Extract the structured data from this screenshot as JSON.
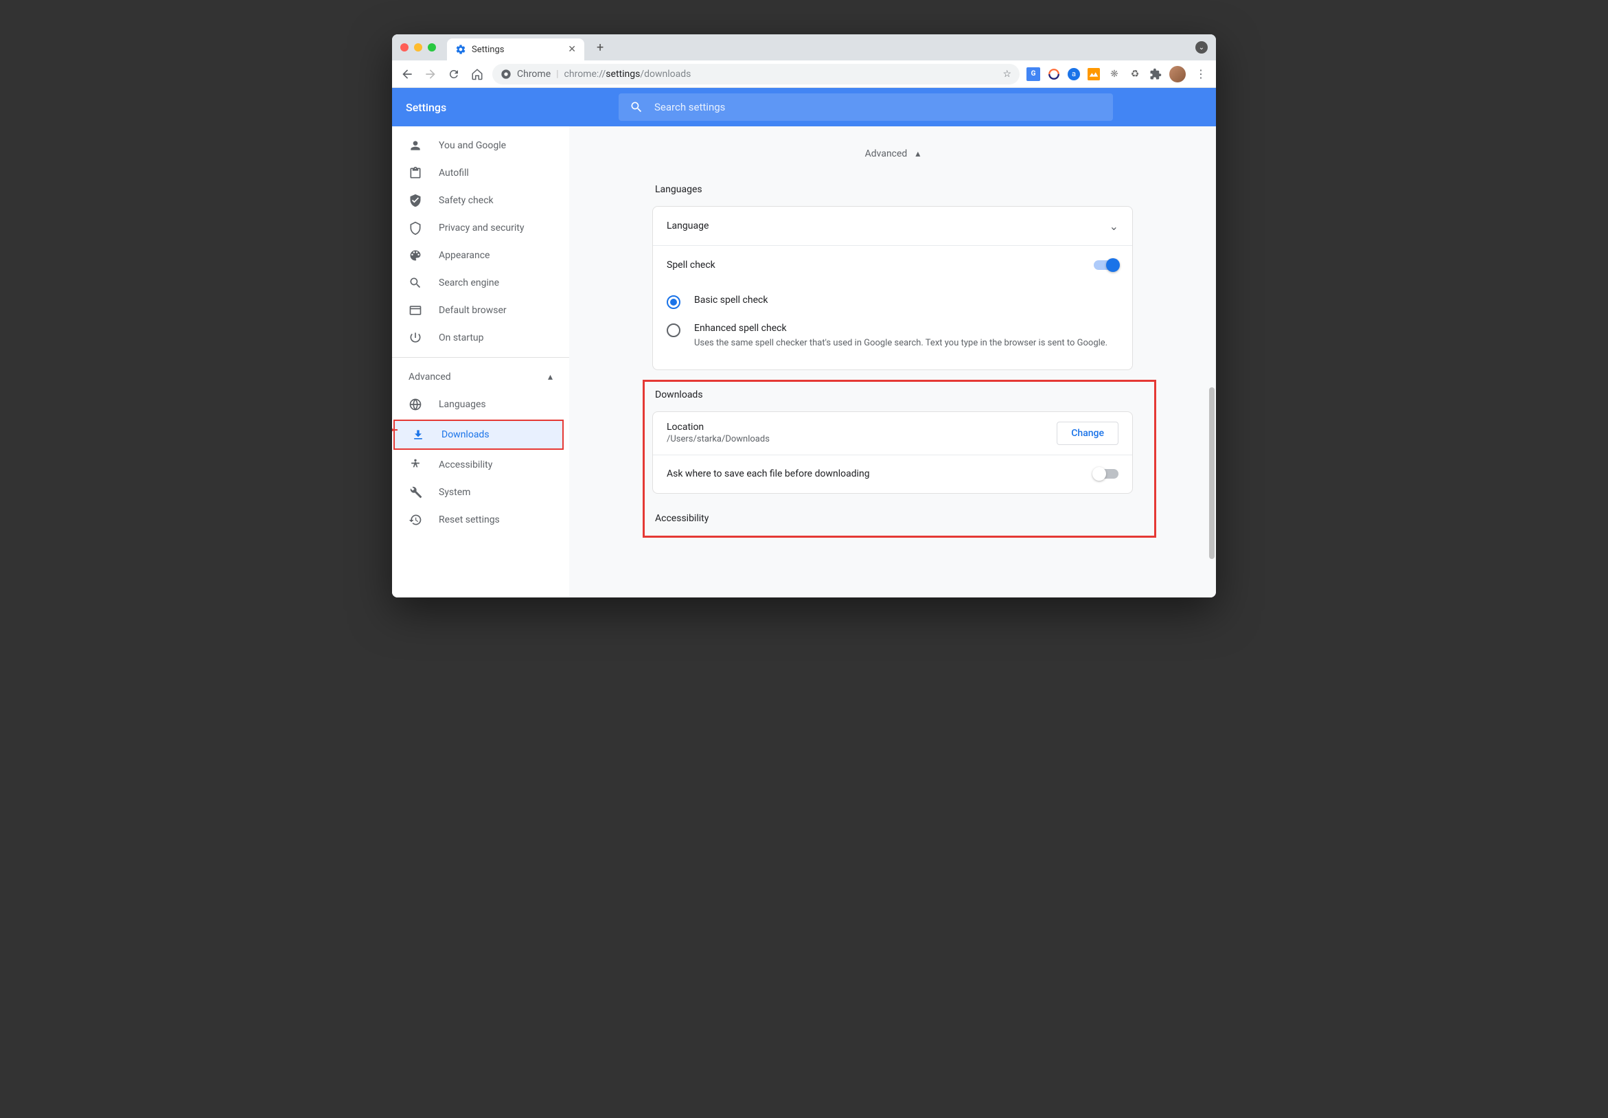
{
  "tab": {
    "title": "Settings"
  },
  "omnibox": {
    "scheme_label": "Chrome",
    "path_light": "chrome://",
    "path_bold": "settings",
    "path_rest": "/downloads"
  },
  "header": {
    "title": "Settings",
    "search_placeholder": "Search settings"
  },
  "sidebar": {
    "items": [
      {
        "icon": "person",
        "label": "You and Google"
      },
      {
        "icon": "autofill",
        "label": "Autofill"
      },
      {
        "icon": "shield-check",
        "label": "Safety check"
      },
      {
        "icon": "shield",
        "label": "Privacy and security"
      },
      {
        "icon": "palette",
        "label": "Appearance"
      },
      {
        "icon": "search",
        "label": "Search engine"
      },
      {
        "icon": "browser",
        "label": "Default browser"
      },
      {
        "icon": "power",
        "label": "On startup"
      }
    ],
    "advanced_label": "Advanced",
    "advanced_items": [
      {
        "icon": "globe",
        "label": "Languages"
      },
      {
        "icon": "download",
        "label": "Downloads",
        "active": true
      },
      {
        "icon": "accessibility",
        "label": "Accessibility"
      },
      {
        "icon": "wrench",
        "label": "System"
      },
      {
        "icon": "restore",
        "label": "Reset settings"
      }
    ]
  },
  "main": {
    "advanced_header": "Advanced",
    "sections": {
      "languages": {
        "title": "Languages",
        "language_row": "Language",
        "spellcheck_row": "Spell check",
        "spellcheck_on": true,
        "radio_basic": "Basic spell check",
        "radio_enhanced": "Enhanced spell check",
        "radio_enhanced_desc": "Uses the same spell checker that's used in Google search. Text you type in the browser is sent to Google."
      },
      "downloads": {
        "title": "Downloads",
        "location_label": "Location",
        "location_value": "/Users/starka/Downloads",
        "change_button": "Change",
        "ask_label": "Ask where to save each file before downloading",
        "ask_on": false
      },
      "accessibility": {
        "title": "Accessibility"
      }
    }
  }
}
